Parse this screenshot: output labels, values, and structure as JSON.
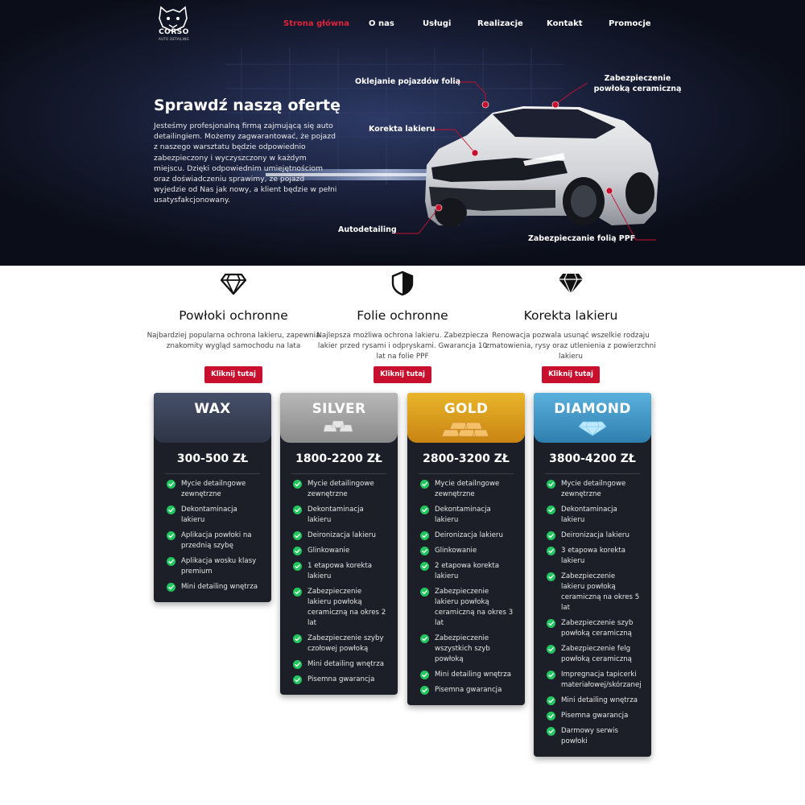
{
  "nav": {
    "logo_text": "CORSO",
    "logo_sub": "AUTO DETAILING",
    "items": [
      "Strona główna",
      "O nas",
      "Usługi",
      "Realizacje",
      "Kontakt",
      "Promocje"
    ]
  },
  "hero": {
    "title": "Sprawdź naszą ofertę",
    "text": "Jesteśmy profesjonalną firmą zajmującą się auto detailingiem. Możemy zagwarantować, że pojazd z naszego warsztatu będzie odpowiednio zabezpieczony i wyczyszczony w każdym miejscu. Dzięki odpowiednim umiejętnościom oraz doświadczeniu sprawimy, że pojazd wyjedzie od Nas jak nowy, a klient będzie w pełni usatysfakcjonowany.",
    "callouts": {
      "wrap": "Oklejanie pojazdów folią",
      "correction": "Korekta lakieru",
      "autodetailing": "Autodetailing",
      "ceramic": "Zabezpieczenie powłoką ceramiczną",
      "ppf": "Zabezpieczanie folią PPF"
    }
  },
  "services": [
    {
      "icon": "diamond-outline-icon",
      "title": "Powłoki ochronne",
      "desc": "Najbardziej popularna ochrona lakieru, zapewnia znakomity wygląd samochodu na lata",
      "button": "Kliknij tutaj"
    },
    {
      "icon": "shield-icon",
      "title": "Folie ochronne",
      "desc": "Najlepsza możliwa ochrona lakieru. Zabezpiecza lakier przed rysami i odpryskami. Gwarancja 10 lat na folie PPF",
      "button": "Kliknij tutaj"
    },
    {
      "icon": "diamond-solid-icon",
      "title": "Korekta lakieru",
      "desc": "Renowacja pozwala usunąć wszelkie rodzaju zmatowienia, rysy oraz utlenienia z powierzchni lakieru",
      "button": "Kliknij tutaj"
    }
  ],
  "plans": [
    {
      "name": "WAX",
      "price": "300-500 ZŁ",
      "color": "#3a4255",
      "features": [
        "Mycie detailngowe zewnętrzne",
        "Dekontaminacja lakieru",
        "Aplikacja powłoki na przednią szybę",
        "Aplikacja wosku klasy premium",
        "Mini detailing wnętrza"
      ]
    },
    {
      "name": "SILVER",
      "price": "1800-2200 ZŁ",
      "color": "#9a9a9a",
      "features": [
        "Mycie detailingowe zewnętrzne",
        "Dekontaminacja lakieru",
        "Deironizacja lakieru",
        "Glinkowanie",
        "1 etapowa korekta lakieru",
        "Zabezpieczenie lakieru powłoką ceramiczną na okres 2 lat",
        "Zabezpieczenie szyby czołowej powłoką",
        "Mini detailing wnętrza",
        "Pisemna gwarancja"
      ]
    },
    {
      "name": "GOLD",
      "price": "2800-3200 ZŁ",
      "color": "#d79a12",
      "features": [
        "Mycie detailngowe zewnętrzne",
        "Dekontaminacja lakieru",
        "Deironizacja lakieru",
        "Glinkowanie",
        "2 etapowa korekta lakieru",
        "Zabezpieczenie lakieru powłoką ceramiczną na okres 3 lat",
        "Zabezpieczenie wszystkich szyb powłoką",
        "Mini detailing wnętrza",
        "Pisemna gwarancja"
      ]
    },
    {
      "name": "DIAMOND",
      "price": "3800-4200 ZŁ",
      "color": "#3f95c4",
      "features": [
        "Mycie detailngowe zewnętrzne",
        "Dekontaminacja lakieru",
        "Deironizacja lakieru",
        "3 etapowa korekta lakieru",
        "Zabezpieczenie lakieru powłoką ceramiczną na okres 5 lat",
        "Zabezpieczenie szyb powłoką ceramiczną",
        "Zabezpieczenie felg powłoką ceramiczną",
        "Impregnacja tapicerki materiałowej/skórzanej",
        "Mini detailing wnętrza",
        "Pisemna gwarancja",
        "Darmowy serwis powłoki"
      ]
    }
  ]
}
